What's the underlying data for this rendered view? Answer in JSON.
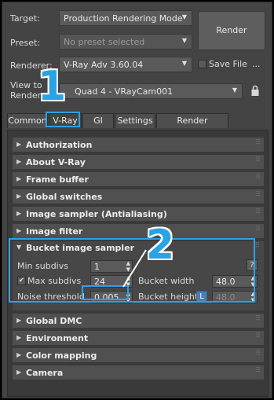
{
  "header": {
    "target_label": "Target:",
    "target_value": "Production Rendering Mode",
    "preset_label": "Preset:",
    "preset_placeholder": "No preset selected",
    "renderer_label": "Renderer:",
    "renderer_value": "V-Ray Adv 3.60.04",
    "save_file_label": "Save File",
    "more_label": "...",
    "view_label_line1": "View to",
    "view_label_line2": "Render:",
    "view_value": "Quad 4 - VRayCam001",
    "render_button": "Render"
  },
  "tabs": [
    {
      "label": "Common"
    },
    {
      "label": "V-Ray"
    },
    {
      "label": "GI"
    },
    {
      "label": "Settings"
    },
    {
      "label": "Render Elements"
    }
  ],
  "rollouts_top": [
    {
      "title": "Authorization"
    },
    {
      "title": "About V-Ray"
    },
    {
      "title": "Frame buffer"
    },
    {
      "title": "Global switches"
    },
    {
      "title": "Image sampler (Antialiasing)"
    },
    {
      "title": "Image filter"
    }
  ],
  "bucket": {
    "title": "Bucket image sampler",
    "min_subdivs_label": "Min subdivs",
    "min_subdivs_value": "1",
    "max_subdivs_label": "Max subdivs",
    "max_subdivs_value": "24",
    "max_subdivs_checked": true,
    "noise_threshold_label": "Noise threshold",
    "noise_threshold_value": "0.005",
    "bucket_width_label": "Bucket width",
    "bucket_width_value": "48.0",
    "bucket_height_label": "Bucket height",
    "bucket_height_value": "48.0",
    "lock_label": "L",
    "help_label": "?"
  },
  "rollouts_bottom": [
    {
      "title": "Global DMC"
    },
    {
      "title": "Environment"
    },
    {
      "title": "Color mapping"
    },
    {
      "title": "Camera"
    }
  ],
  "callouts": {
    "one": "1",
    "two": "2"
  },
  "colors": {
    "accent": "#29a3e6",
    "panel_bg": "#444444",
    "rollout_bg": "#505050"
  }
}
